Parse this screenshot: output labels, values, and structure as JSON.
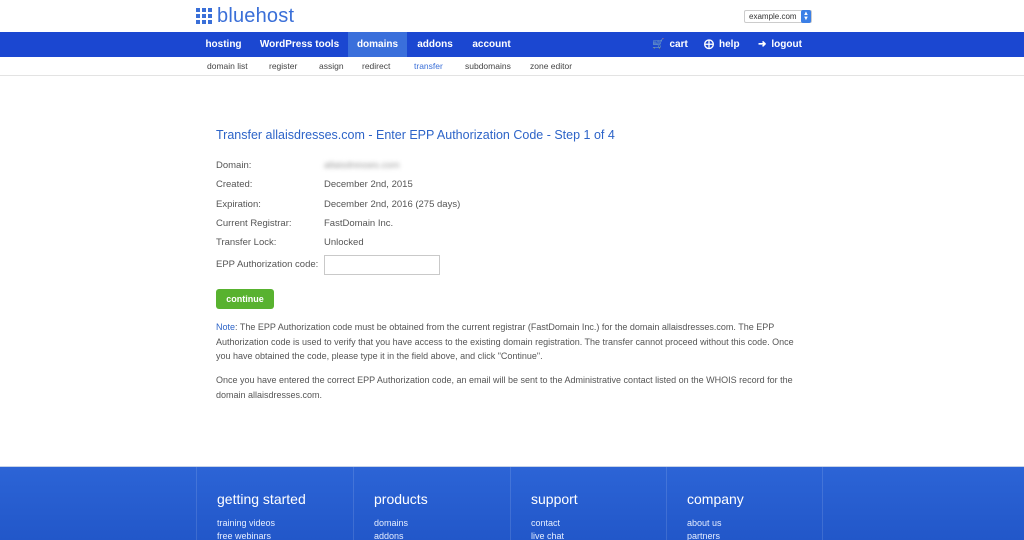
{
  "header": {
    "logo_text": "bluehost",
    "domain_select": {
      "value": "example.com"
    }
  },
  "colors": {
    "brand_blue": "#1b47d1",
    "active_tab": "#3a6fdb",
    "link_blue": "#2d64c8",
    "button_green": "#58b22f",
    "footer_blue": "#2c64d6"
  },
  "mainnav": {
    "items": [
      {
        "label": "hosting"
      },
      {
        "label": "WordPress tools"
      },
      {
        "label": "domains",
        "active": true
      },
      {
        "label": "addons"
      },
      {
        "label": "account"
      }
    ],
    "right": [
      {
        "label": "cart",
        "icon": "cart-icon"
      },
      {
        "label": "help",
        "icon": "lifebuoy-icon"
      },
      {
        "label": "logout",
        "icon": "logout-icon"
      }
    ]
  },
  "subnav": {
    "items": [
      {
        "label": "domain list"
      },
      {
        "label": "register"
      },
      {
        "label": "assign"
      },
      {
        "label": "redirect"
      },
      {
        "label": "transfer",
        "active": true
      },
      {
        "label": "subdomains"
      },
      {
        "label": "zone editor"
      }
    ]
  },
  "main": {
    "title": "Transfer allaisdresses.com - Enter EPP Authorization Code - Step 1 of 4",
    "fields": [
      {
        "label": "Domain:",
        "value": "allaisdresses.com",
        "blurred": true
      },
      {
        "label": "Created:",
        "value": "December 2nd, 2015"
      },
      {
        "label": "Expiration:",
        "value": "December 2nd, 2016 (275 days)"
      },
      {
        "label": "Current Registrar:",
        "value": "FastDomain Inc."
      },
      {
        "label": "Transfer Lock:",
        "value": "Unlocked"
      }
    ],
    "epp": {
      "label": "EPP Authorization code:",
      "value": "",
      "placeholder": ""
    },
    "continue_label": "continue",
    "note_label": "Note",
    "note_text": ": The EPP Authorization code must be obtained from the current registrar (FastDomain Inc.) for the domain allaisdresses.com. The EPP Authorization code is used to verify that you have access to the existing domain registration. The transfer cannot proceed without this code. Once you have obtained the code, please type it in the field above, and click \"Continue\".",
    "note2": "Once you have entered the correct EPP Authorization code, an email will be sent to the Administrative contact listed on the WHOIS record for the domain allaisdresses.com."
  },
  "footer": {
    "columns": [
      {
        "heading": "getting started",
        "links": [
          "training videos",
          "free webinars"
        ]
      },
      {
        "heading": "products",
        "links": [
          "domains",
          "addons"
        ]
      },
      {
        "heading": "support",
        "links": [
          "contact",
          "live chat"
        ]
      },
      {
        "heading": "company",
        "links": [
          "about us",
          "partners"
        ]
      }
    ]
  }
}
